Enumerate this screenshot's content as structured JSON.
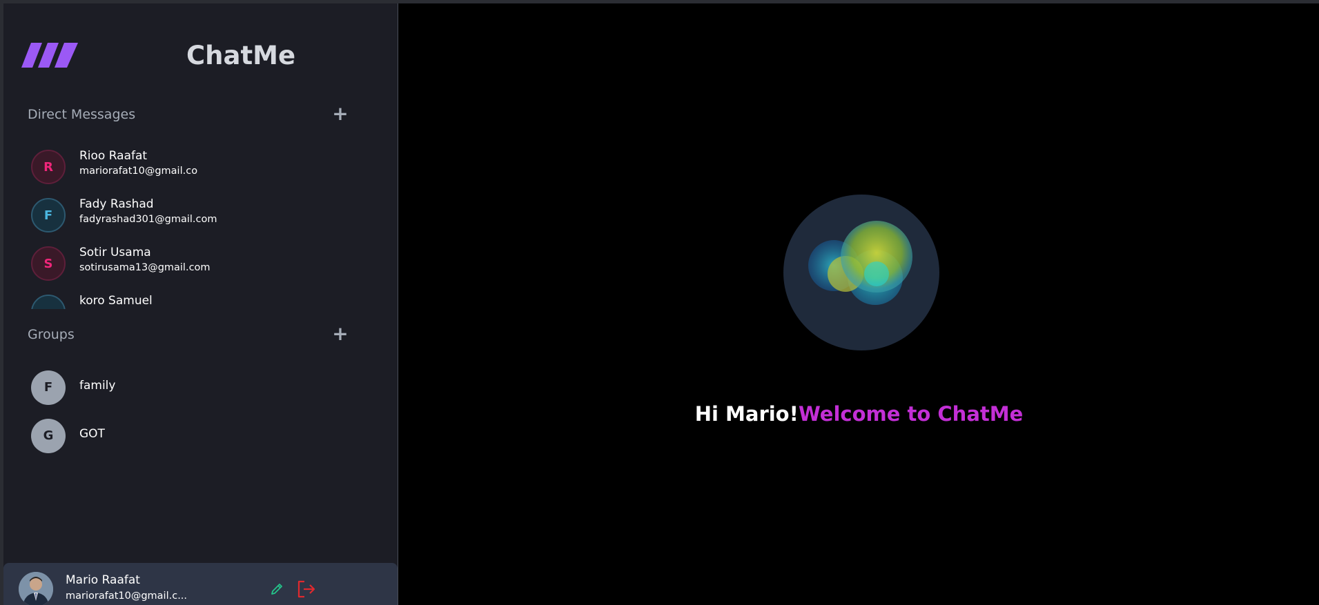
{
  "app": {
    "title": "ChatMe"
  },
  "sections": {
    "dm_title": "Direct Messages",
    "groups_title": "Groups"
  },
  "contacts": [
    {
      "initial": "R",
      "name": "Rioo Raafat",
      "email": "mariorafat10@gmail.co",
      "color": "pink"
    },
    {
      "initial": "F",
      "name": "Fady Rashad",
      "email": "fadyrashad301@gmail.com",
      "color": "blue"
    },
    {
      "initial": "S",
      "name": "Sotir Usama",
      "email": "sotirusama13@gmail.com",
      "color": "pink"
    },
    {
      "initial": "",
      "name": "koro Samuel",
      "email": "",
      "color": "blue"
    }
  ],
  "groups": [
    {
      "initial": "F",
      "name": "family"
    },
    {
      "initial": "G",
      "name": "GOT"
    }
  ],
  "profile": {
    "name": "Mario Raafat",
    "email": "mariorafat10@gmail.c..."
  },
  "welcome": {
    "greeting": "Hi Mario!",
    "message": "Welcome to ChatMe"
  },
  "icons": {
    "add": "plus-icon",
    "edit": "pencil-icon",
    "logout": "logout-icon"
  },
  "colors": {
    "accent": "#c32fd6",
    "logo": "#9b59f5",
    "logout": "#e0292e",
    "edit": "#24c48a"
  }
}
